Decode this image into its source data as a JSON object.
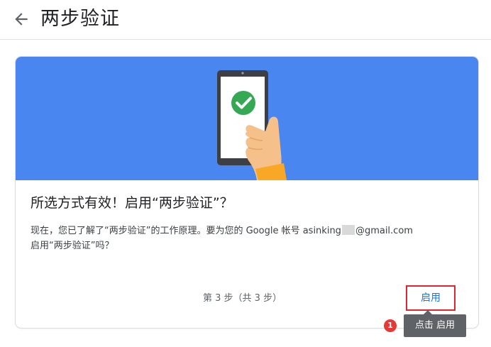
{
  "header": {
    "back_icon": "arrow-left-icon",
    "title": "两步验证"
  },
  "card": {
    "banner_color": "#4a86f0",
    "illustration": "phone-with-check-icon",
    "heading": "所选方式有效！启用“两步验证”？",
    "description_line1_pre": "现在，您已了解了“两步验证”的工作原理。要为您的 Google 帐号 asinking",
    "description_line1_post": "@gmail.com",
    "description_line2": "启用“两步验证”吗？",
    "step_text": "第 3 步（共 3 步）",
    "enable_label": "启用"
  },
  "annotation": {
    "badge_number": "1",
    "tooltip_text": "点击 启用",
    "highlight_color": "#e0262e"
  }
}
